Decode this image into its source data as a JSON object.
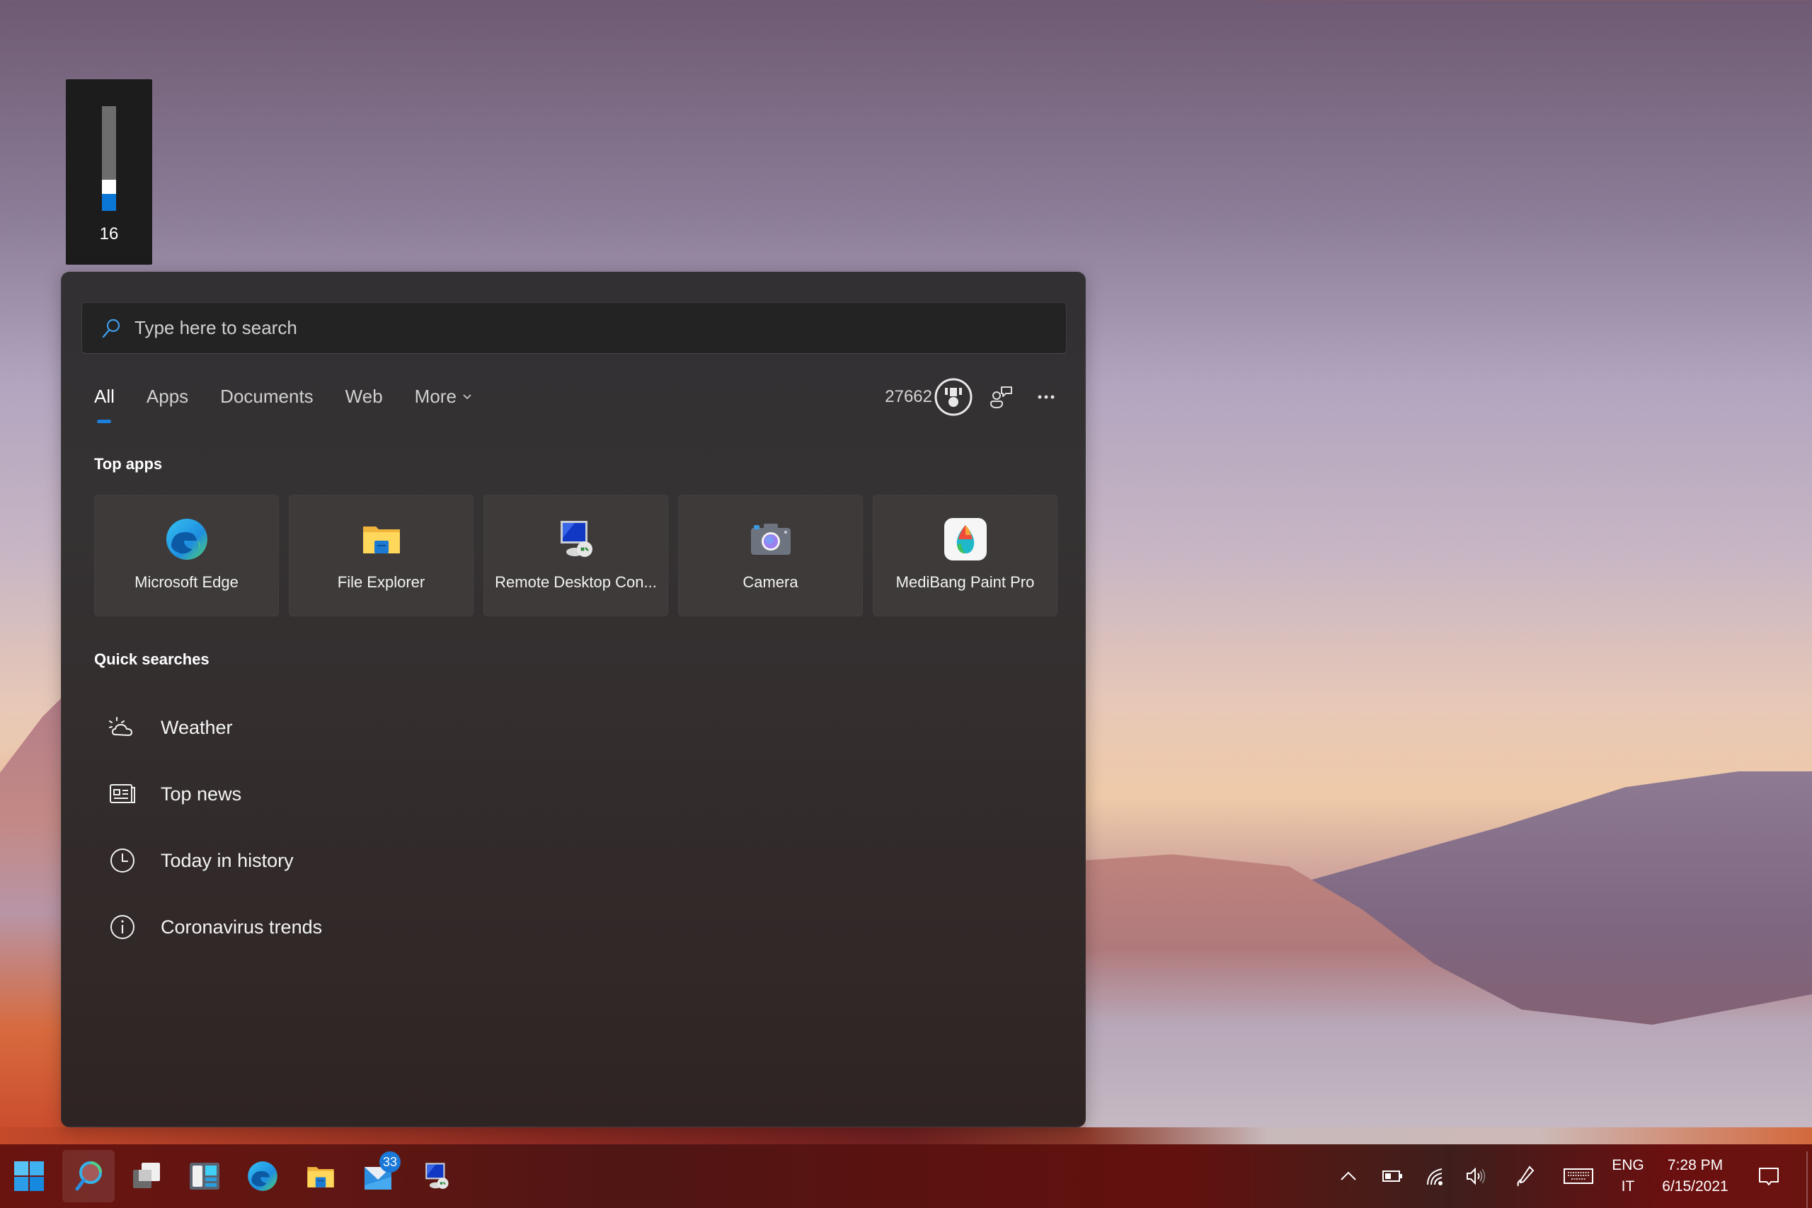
{
  "volume_osd": {
    "level_percent": 16,
    "value_label": "16"
  },
  "search": {
    "placeholder": "Type here to search",
    "value": ""
  },
  "tabs": [
    {
      "label": "All",
      "active": true
    },
    {
      "label": "Apps",
      "active": false
    },
    {
      "label": "Documents",
      "active": false
    },
    {
      "label": "Web",
      "active": false
    },
    {
      "label": "More",
      "active": false
    }
  ],
  "header": {
    "points": "27662",
    "rewards_icon": "trophy-medal-icon",
    "feedback_icon": "feedback-person-icon",
    "more_icon": "ellipsis-icon"
  },
  "top_apps": {
    "label": "Top apps",
    "items": [
      {
        "label": "Microsoft Edge",
        "icon": "edge-icon"
      },
      {
        "label": "File Explorer",
        "icon": "folder-icon"
      },
      {
        "label": "Remote Desktop Con...",
        "icon": "remote-desktop-icon"
      },
      {
        "label": "Camera",
        "icon": "camera-icon"
      },
      {
        "label": "MediBang Paint Pro",
        "icon": "medibang-icon"
      }
    ]
  },
  "quick_searches": {
    "label": "Quick searches",
    "items": [
      {
        "label": "Weather",
        "icon": "weather-icon"
      },
      {
        "label": "Top news",
        "icon": "news-icon"
      },
      {
        "label": "Today in history",
        "icon": "clock-icon"
      },
      {
        "label": "Coronavirus trends",
        "icon": "info-icon"
      }
    ]
  },
  "taskbar": {
    "pinned": [
      {
        "name": "Start",
        "icon": "windows-start-icon"
      },
      {
        "name": "Search",
        "icon": "search-icon",
        "active": true
      },
      {
        "name": "Task View",
        "icon": "task-view-icon"
      },
      {
        "name": "Widgets",
        "icon": "widgets-icon"
      },
      {
        "name": "Microsoft Edge",
        "icon": "edge-icon"
      },
      {
        "name": "File Explorer",
        "icon": "folder-icon"
      },
      {
        "name": "Mail",
        "icon": "mail-icon",
        "badge": "33"
      },
      {
        "name": "Remote Desktop Connection",
        "icon": "remote-desktop-icon"
      }
    ],
    "tray": {
      "language_line1": "ENG",
      "language_line2": "IT",
      "time": "7:28 PM",
      "date": "6/15/2021"
    }
  },
  "colors": {
    "accent": "#1b7fdc",
    "panel_bg": "#333033",
    "tile_bg": "#3e3a39",
    "taskbar_bg": "#5f1612",
    "badge_bg": "#1a78d8"
  }
}
